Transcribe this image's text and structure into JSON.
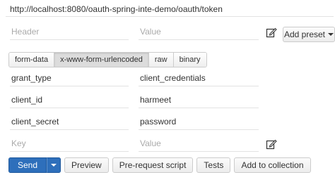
{
  "url": {
    "value": "http://localhost:8080/oauth-spring-inte-demo/oauth/token"
  },
  "headers": {
    "key_placeholder": "Header",
    "value_placeholder": "Value",
    "preset_label": "Add preset"
  },
  "body_tabs": [
    "form-data",
    "x-www-form-urlencoded",
    "raw",
    "binary"
  ],
  "active_tab": "x-www-form-urlencoded",
  "params": [
    {
      "key": "grant_type",
      "value": "client_credentials"
    },
    {
      "key": "client_id",
      "value": "harmeet"
    },
    {
      "key": "client_secret",
      "value": "password"
    }
  ],
  "new_param": {
    "key_placeholder": "Key",
    "value_placeholder": "Value"
  },
  "actions": {
    "send": "Send",
    "preview": "Preview",
    "prerequest": "Pre-request script",
    "tests": "Tests",
    "add_collection": "Add to collection"
  },
  "icons": {
    "edit": "edit-pencil-icon",
    "dropdown": "chevron-down-icon"
  },
  "colors": {
    "send_button": "#2e6fbb"
  }
}
